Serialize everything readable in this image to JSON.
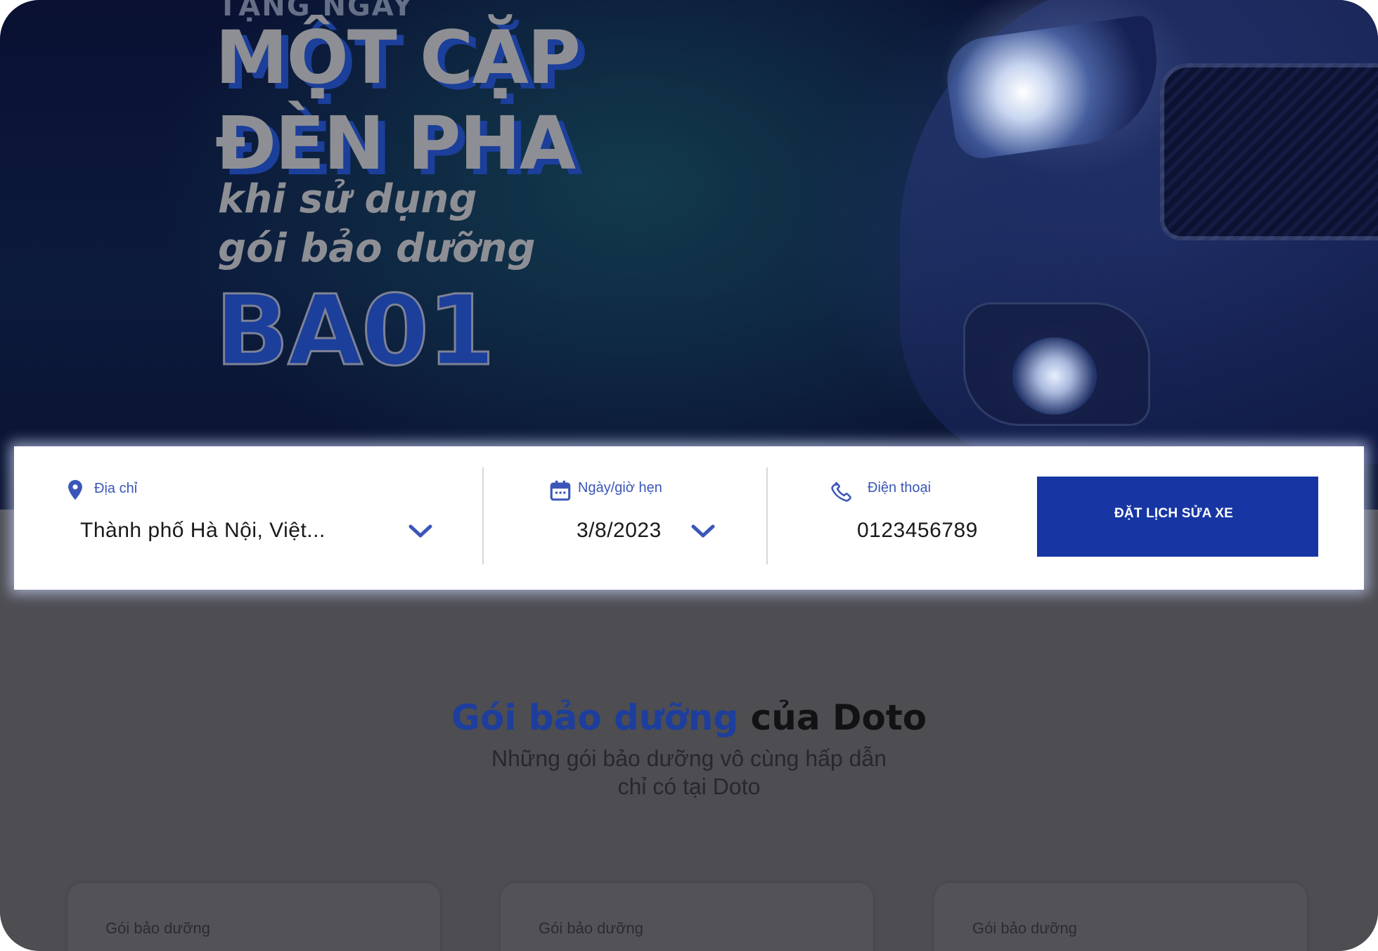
{
  "hero": {
    "promo_top": "TẶNG NGAY",
    "promo_line1": "MỘT CẶP",
    "promo_line2": "ĐÈN PHA",
    "promo_line3": "khi sử dụng",
    "promo_line4": "gói bảo dưỡng",
    "promo_code": "BA01"
  },
  "booking": {
    "address": {
      "label": "Địa chỉ",
      "value": "Thành phố Hà Nội, Việt..."
    },
    "date": {
      "label": "Ngày/giờ hẹn",
      "value": "3/8/2023"
    },
    "phone": {
      "label": "Điện thoại",
      "value": "0123456789"
    },
    "submit_label": "ĐẶT LỊCH SỬA XE"
  },
  "section": {
    "title_accent": "Gói bảo dưỡng",
    "title_plain": "của Doto",
    "subtitle_line1": "Những gói bảo dưỡng vô cùng hấp dẫn",
    "subtitle_line2": "chỉ có tại Doto"
  },
  "cards": [
    {
      "label": "Gói bảo dưỡng"
    },
    {
      "label": "Gói bảo dưỡng"
    },
    {
      "label": "Gói bảo dưỡng"
    }
  ],
  "colors": {
    "brand_blue": "#1736a3",
    "label_blue": "#3b56b8",
    "overlay": "#4d4d52"
  },
  "icons": [
    "map-pin-icon",
    "calendar-icon",
    "phone-icon",
    "chevron-down-icon"
  ]
}
